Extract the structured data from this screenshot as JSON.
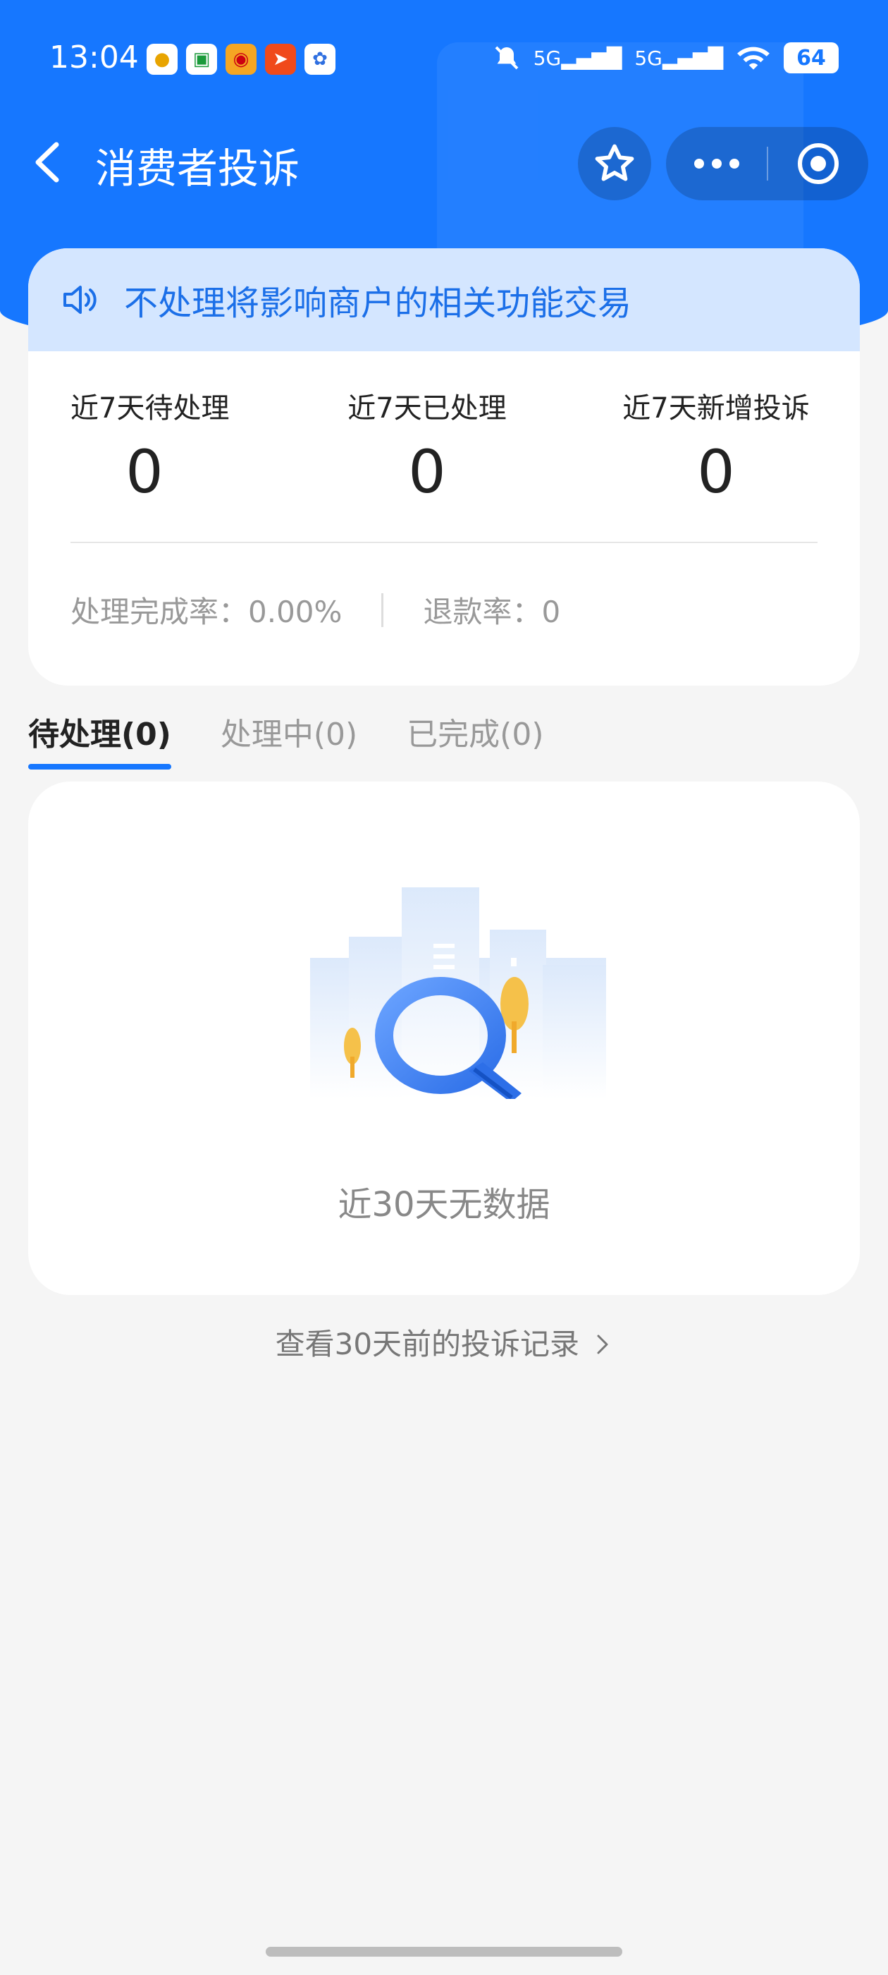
{
  "status_bar": {
    "time": "13:04",
    "battery": "64",
    "signal_1": "5G",
    "signal_2": "5G"
  },
  "header": {
    "title": "消费者投诉"
  },
  "notice": {
    "text": "不处理将影响商户的相关功能交易"
  },
  "stats": [
    {
      "label": "近7天待处理",
      "value": "0"
    },
    {
      "label": "近7天已处理",
      "value": "0"
    },
    {
      "label": "近7天新增投诉",
      "value": "0"
    }
  ],
  "rates": {
    "completion_label": "处理完成率：",
    "completion_value": "0.00%",
    "refund_label": "退款率：",
    "refund_value": "0"
  },
  "tabs": [
    {
      "label": "待处理(0)",
      "active": true
    },
    {
      "label": "处理中(0)",
      "active": false
    },
    {
      "label": "已完成(0)",
      "active": false
    }
  ],
  "empty_state": {
    "text": "近30天无数据"
  },
  "history_link": {
    "text": "查看30天前的投诉记录"
  },
  "colors": {
    "primary": "#1677ff",
    "notice_bg": "#d4e6ff",
    "page_bg": "#f5f5f5"
  }
}
